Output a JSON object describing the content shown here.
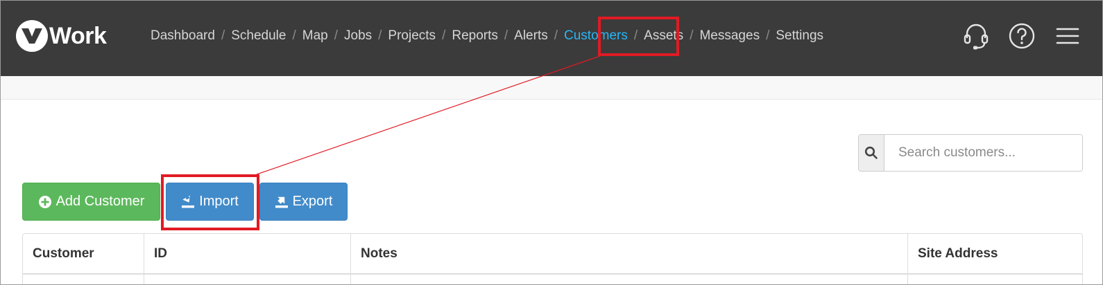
{
  "brand": {
    "logo_letter": "v",
    "logo_word": "Work"
  },
  "nav": {
    "items": [
      {
        "label": "Dashboard",
        "active": false
      },
      {
        "label": "Schedule",
        "active": false
      },
      {
        "label": "Map",
        "active": false
      },
      {
        "label": "Jobs",
        "active": false
      },
      {
        "label": "Projects",
        "active": false
      },
      {
        "label": "Reports",
        "active": false
      },
      {
        "label": "Alerts",
        "active": false
      },
      {
        "label": "Customers",
        "active": true
      },
      {
        "label": "Assets",
        "active": false
      },
      {
        "label": "Messages",
        "active": false
      },
      {
        "label": "Settings",
        "active": false
      }
    ],
    "separator": "/",
    "right_icons": [
      "headset-icon",
      "help-icon",
      "menu-icon"
    ]
  },
  "search": {
    "placeholder": "Search customers...",
    "value": "",
    "icon": "search-icon"
  },
  "actions": {
    "add_label": "Add Customer",
    "import_label": "Import",
    "export_label": "Export"
  },
  "table": {
    "columns": [
      "Customer",
      "ID",
      "Notes",
      "Site Address"
    ]
  },
  "colors": {
    "topbar": "#3b3b3b",
    "nav_text": "#d6d6d6",
    "nav_active": "#29b6f6",
    "success": "#5cb85c",
    "primary": "#428bca",
    "annotation": "#e01b24"
  }
}
